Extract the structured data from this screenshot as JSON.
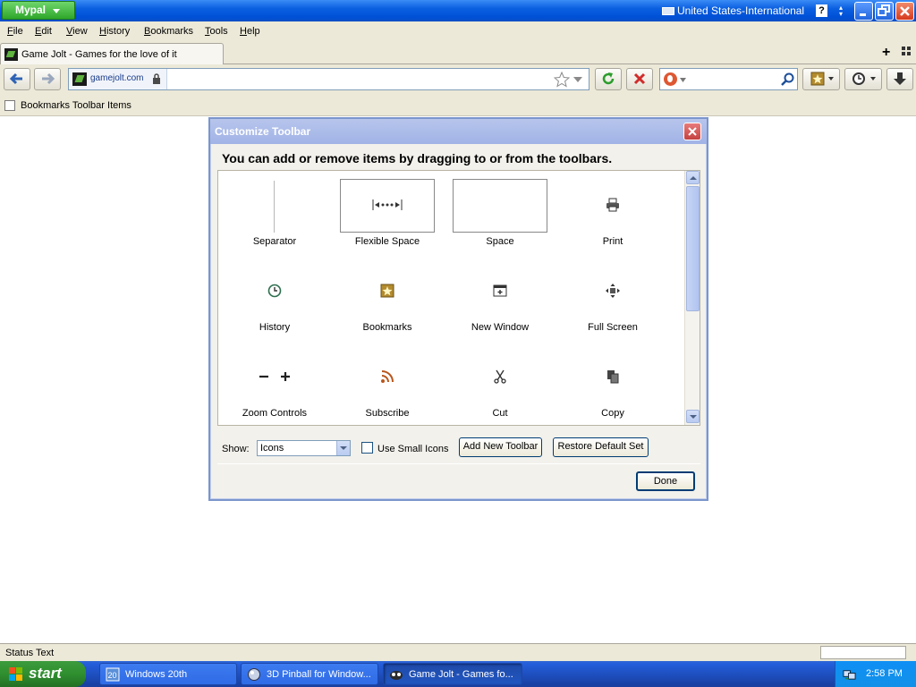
{
  "titlebar": {
    "app_button": "Mypal",
    "language": "United States-International",
    "help": "?",
    "colors": {
      "accent": "#0a5fe0",
      "app_button": "#2ea62a"
    }
  },
  "menu": {
    "items": [
      {
        "label": "File",
        "accel": "F",
        "rest": "ile"
      },
      {
        "label": "Edit",
        "accel": "E",
        "rest": "dit"
      },
      {
        "label": "View",
        "accel": "V",
        "rest": "iew"
      },
      {
        "label": "History",
        "accel": "H",
        "rest": "istory"
      },
      {
        "label": "Bookmarks",
        "accel": "B",
        "rest": "ookmarks"
      },
      {
        "label": "Tools",
        "accel": "T",
        "rest": "ools"
      },
      {
        "label": "Help",
        "accel": "H",
        "rest": "elp"
      }
    ]
  },
  "tabs": [
    {
      "title": "Game Jolt - Games for the love of it",
      "favicon": "gamejolt-icon"
    }
  ],
  "navbar": {
    "domain": "gamejolt.com",
    "url": "",
    "search_value": ""
  },
  "bookmarks_toolbar": {
    "label": "Bookmarks Toolbar Items"
  },
  "dialog": {
    "title": "Customize Toolbar",
    "instruction": "You can add or remove items by dragging to or from the toolbars.",
    "items": [
      {
        "label": "Separator",
        "icon": "separator"
      },
      {
        "label": "Flexible Space",
        "icon": "flexible-space-icon"
      },
      {
        "label": "Space",
        "icon": "space"
      },
      {
        "label": "Print",
        "icon": "print-icon"
      },
      {
        "label": "History",
        "icon": "history-icon"
      },
      {
        "label": "Bookmarks",
        "icon": "bookmarks-icon"
      },
      {
        "label": "New Window",
        "icon": "new-window-icon"
      },
      {
        "label": "Full Screen",
        "icon": "full-screen-icon"
      },
      {
        "label": "Zoom Controls",
        "icon": "zoom-controls-icon"
      },
      {
        "label": "Subscribe",
        "icon": "rss-icon"
      },
      {
        "label": "Cut",
        "icon": "scissors-icon"
      },
      {
        "label": "Copy",
        "icon": "copy-icon"
      }
    ],
    "show_label": "Show:",
    "show_value": "Icons",
    "small_icons_label": "Use Small Icons",
    "small_icons_checked": false,
    "add_toolbar_label": "Add New Toolbar",
    "restore_label": "Restore Default Set",
    "done_label": "Done"
  },
  "statusbar": {
    "text": "Status Text"
  },
  "taskbar": {
    "start_label": "start",
    "tasks": [
      {
        "label": "Windows 20th",
        "active": false
      },
      {
        "label": "3D Pinball for Window...",
        "active": false
      },
      {
        "label": "Game Jolt - Games fo...",
        "active": true
      }
    ],
    "clock": "2:58 PM"
  }
}
